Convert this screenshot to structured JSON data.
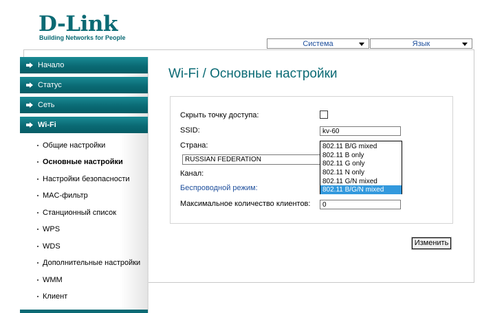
{
  "logo": {
    "name": "D-Link",
    "tagline": "Building Networks for People"
  },
  "header": {
    "system_menu": "Система",
    "language_menu": "Язык"
  },
  "sidebar": {
    "main_items": [
      {
        "label": "Начало",
        "active": false
      },
      {
        "label": "Статус",
        "active": false
      },
      {
        "label": "Сеть",
        "active": false
      },
      {
        "label": "Wi-Fi",
        "active": true
      }
    ],
    "sub_items": [
      {
        "label": "Общие настройки",
        "current": false
      },
      {
        "label": "Основные настройки",
        "current": true
      },
      {
        "label": "Настройки безопасности",
        "current": false
      },
      {
        "label": "MAC-фильтр",
        "current": false
      },
      {
        "label": "Станционный список",
        "current": false
      },
      {
        "label": "WPS",
        "current": false
      },
      {
        "label": "WDS",
        "current": false
      },
      {
        "label": "Дополнительные настройки",
        "current": false
      },
      {
        "label": "WMM",
        "current": false
      },
      {
        "label": "Клиент",
        "current": false
      }
    ]
  },
  "page": {
    "title": "Wi-Fi  / Основные настройки"
  },
  "form": {
    "hide_ap_label": "Скрыть точку доступа:",
    "hide_ap_checked": false,
    "ssid_label": "SSID:",
    "ssid_value": "kv-60",
    "country_label": "Страна:",
    "country_value": "RUSSIAN FEDERATION",
    "channel_label": "Канал:",
    "mode_label": "Беспроводной режим:",
    "mode_options": [
      "802.11 B/G mixed",
      "802.11 B only",
      "802.11 G only",
      "802.11 N only",
      "802.11 G/N mixed",
      "802.11 B/G/N mixed"
    ],
    "mode_selected": "802.11 B/G/N mixed",
    "max_clients_label": "Максимальное количество клиентов:",
    "max_clients_value": "0",
    "change_button": "Изменить"
  },
  "colors": {
    "brand": "#0a6a74",
    "link": "#1e4f9c",
    "selection": "#3399dd"
  }
}
